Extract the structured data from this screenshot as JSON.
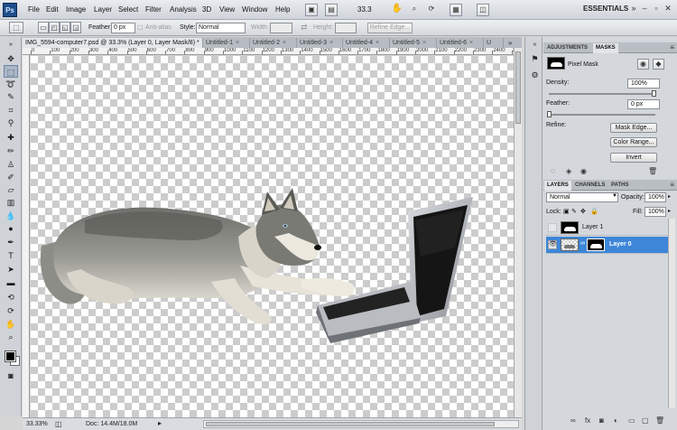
{
  "app": {
    "logo": "Ps",
    "workspace": "ESSENTIALS",
    "zoom": "33.3"
  },
  "menu": [
    "File",
    "Edit",
    "Image",
    "Layer",
    "Select",
    "Filter",
    "Analysis",
    "3D",
    "View",
    "Window",
    "Help"
  ],
  "options": {
    "feather_label": "Feather:",
    "feather_value": "0 px",
    "antialias_label": "Anti-alias",
    "style_label": "Style:",
    "style_value": "Normal",
    "width_label": "Width:",
    "height_label": "Height:",
    "refine_edge": "Refine Edge..."
  },
  "tabs": [
    {
      "label": "IMG_5594-computer7.psd @ 33.3% (Layer 0, Layer Mask/8) *",
      "active": true
    },
    {
      "label": "Untitled-1"
    },
    {
      "label": "Untitled-2"
    },
    {
      "label": "Untitled-3"
    },
    {
      "label": "Untitled-4"
    },
    {
      "label": "Untitled-5"
    },
    {
      "label": "Untitled-6"
    },
    {
      "label": "U"
    }
  ],
  "ruler_labels": [
    "0",
    "100",
    "200",
    "300",
    "400",
    "500",
    "600",
    "700",
    "800",
    "900",
    "1000",
    "1100",
    "1200",
    "1300",
    "1400",
    "1500",
    "1600",
    "1700",
    "1800",
    "1900",
    "2000",
    "2100",
    "2200",
    "2300",
    "2400",
    "2500"
  ],
  "status": {
    "zoom": "33.33%",
    "doc": "Doc: 14.4M/18.0M"
  },
  "masks_panel": {
    "tab_adjustments": "ADJUSTMENTS",
    "tab_masks": "MASKS",
    "mask_type": "Pixel Mask",
    "density_label": "Density:",
    "density_value": "100%",
    "feather_label": "Feather:",
    "feather_value": "0 px",
    "refine_label": "Refine:",
    "mask_edge": "Mask Edge...",
    "color_range": "Color Range...",
    "invert": "Invert"
  },
  "layers_panel": {
    "tab_layers": "LAYERS",
    "tab_channels": "CHANNELS",
    "tab_paths": "PATHS",
    "blend_mode": "Normal",
    "opacity_label": "Opacity:",
    "opacity_value": "100%",
    "lock_label": "Lock:",
    "fill_label": "Fill:",
    "fill_value": "100%",
    "layers": [
      {
        "name": "Layer 1",
        "selected": false
      },
      {
        "name": "Layer 0",
        "selected": true
      }
    ]
  },
  "colors": {
    "selection": "#3d86d8",
    "ps_blue": "#1f4f8a"
  }
}
